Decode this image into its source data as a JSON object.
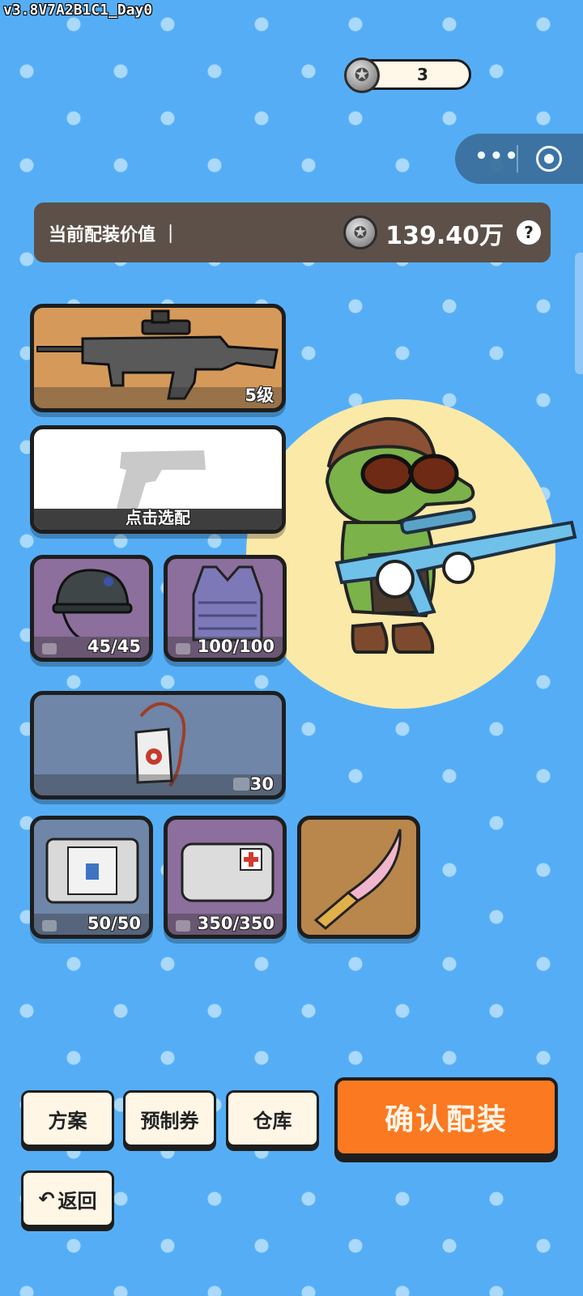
{
  "version": "v3.8V7A2B1C1_Day0",
  "coins": {
    "count": "3",
    "icon": "silver-coin-icon"
  },
  "capsule": {
    "more": "•••"
  },
  "loadout_value": {
    "label": "当前配装价值 ｜",
    "amount": "139.40万",
    "help": "?"
  },
  "slots": {
    "primary": {
      "level": "5级"
    },
    "secondary": {
      "action": "点击选配"
    },
    "helmet": {
      "durability": "45/45"
    },
    "armor": {
      "durability": "100/100"
    },
    "backpack": {
      "capacity": "30"
    },
    "rig": {
      "durability": "50/50"
    },
    "medkit": {
      "durability": "350/350"
    }
  },
  "buttons": {
    "plan": "方案",
    "voucher": "预制券",
    "warehouse": "仓库",
    "confirm": "确认配装",
    "back": "返回",
    "back_icon": "↶"
  },
  "colors": {
    "background": "#55aef5",
    "confirm": "#fa7921",
    "value_bar": "#5c5049"
  }
}
